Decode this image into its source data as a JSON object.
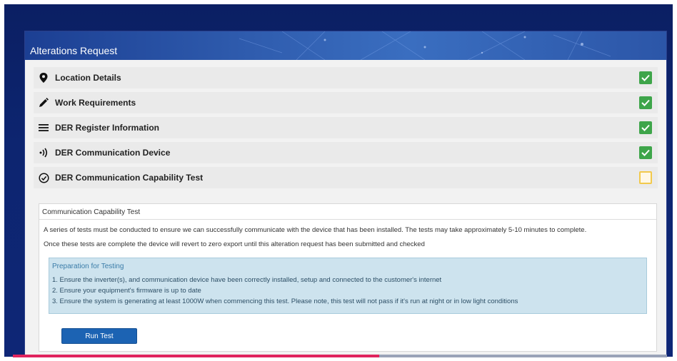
{
  "card": {
    "title": "Alterations Request"
  },
  "steps": [
    {
      "label": "Location Details",
      "icon": "map-pin-icon",
      "status": "complete"
    },
    {
      "label": "Work Requirements",
      "icon": "pencil-icon",
      "status": "complete"
    },
    {
      "label": "DER Register Information",
      "icon": "list-icon",
      "status": "complete"
    },
    {
      "label": "DER Communication Device",
      "icon": "signal-icon",
      "status": "complete"
    },
    {
      "label": "DER Communication Capability Test",
      "icon": "check-circle-icon",
      "status": "pending"
    }
  ],
  "test": {
    "heading": "Communication Capability Test",
    "line1": "A series of tests must be conducted to ensure we can successfully communicate with the device that has been installed. The tests may take approximately 5-10 minutes to complete.",
    "line2": "Once these tests are complete the device will revert to zero export until this alteration request has been submitted and checked",
    "prep_heading": "Preparation for Testing",
    "prep_items": [
      "1. Ensure the inverter(s), and communication device have been correctly installed, setup and connected to the customer's internet",
      "2. Ensure your equipment's firmware is up to date",
      "3. Ensure the system is generating at least 1000W when commencing this test. Please note, this test will not pass if it's run at night or in low light conditions"
    ],
    "run_button": "Run Test"
  },
  "video_progress": 0.56,
  "colors": {
    "background": "#0d2570",
    "header": "#2f5cae",
    "complete": "#3ea54a",
    "pending_border": "#f2c94c",
    "button": "#1c63b3",
    "progress": "#e0245e"
  }
}
